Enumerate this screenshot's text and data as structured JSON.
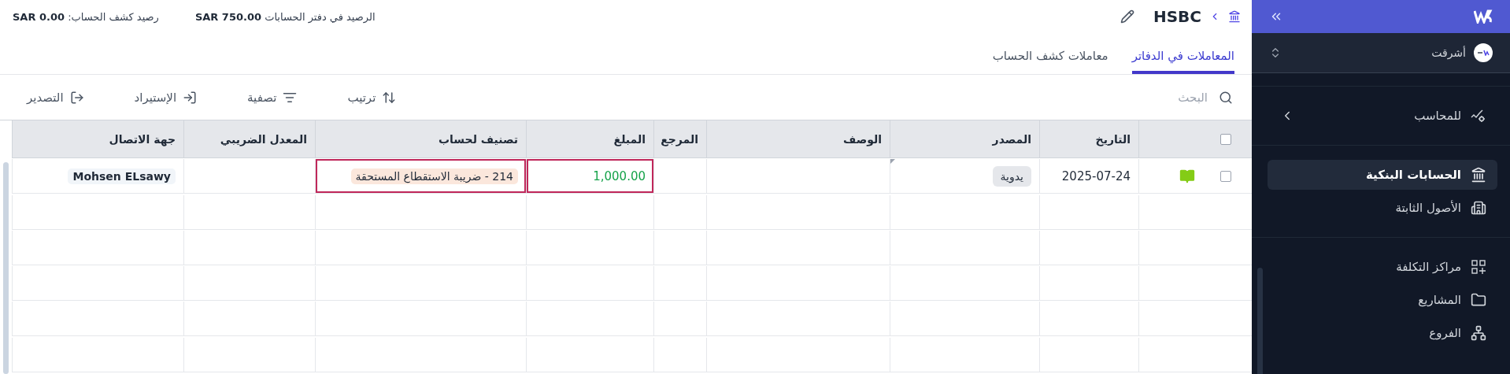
{
  "sidebar": {
    "org": {
      "name": "أشرقت"
    },
    "sections": [
      [
        {
          "label": "للمحاسب",
          "kind": "accountant",
          "selected": false,
          "submenu": true
        }
      ],
      [
        {
          "label": "الحسابات البنكية",
          "kind": "bank",
          "selected": true,
          "submenu": false
        },
        {
          "label": "الأصول الثابتة",
          "kind": "building",
          "selected": false,
          "submenu": false
        }
      ],
      [
        {
          "label": "مراكز التكلفة",
          "kind": "grid",
          "selected": false,
          "submenu": false
        },
        {
          "label": "المشاريع",
          "kind": "folder",
          "selected": false,
          "submenu": false
        },
        {
          "label": "الفروع",
          "kind": "branches",
          "selected": false,
          "submenu": false
        }
      ]
    ]
  },
  "header": {
    "title": "HSBC",
    "balances": [
      "الرصيد في دفتر الحسابات **SAR 750.00**",
      "رصيد كشف الحساب: **SAR 0.00**"
    ]
  },
  "tabs": [
    {
      "label": "المعاملات في الدفاتر",
      "selected": true
    },
    {
      "label": "معاملات كشف الحساب",
      "selected": false
    }
  ],
  "toolbar": {
    "search": {
      "placeholder": "البحث"
    },
    "buttons": [
      {
        "label": "ترتيب",
        "kind": "sort"
      },
      {
        "label": "تصفية",
        "kind": "filter"
      },
      {
        "label": "الإستيراد",
        "kind": "import"
      },
      {
        "label": "التصدير",
        "kind": "export"
      }
    ]
  },
  "table": {
    "select_all": {
      "checked": false
    },
    "columns": [
      {
        "label": "التاريخ"
      },
      {
        "label": "المصدر"
      },
      {
        "label": "الوصف"
      },
      {
        "label": "المرجع"
      },
      {
        "label": "المبلغ"
      },
      {
        "label": "تصنيف لحساب"
      },
      {
        "label": "المعدل الضريبي"
      },
      {
        "label": "جهة الاتصال"
      }
    ],
    "rows": [
      {
        "checked": false,
        "cells": [
          {
            "kind": "text",
            "text": "2025-07-24",
            "selected": false
          },
          {
            "kind": "source",
            "text": "يدوية",
            "selected": false
          },
          {
            "kind": "empty",
            "selected": false
          },
          {
            "kind": "empty",
            "selected": false
          },
          {
            "kind": "amount",
            "text": "1,000.00",
            "selected": true
          },
          {
            "kind": "account",
            "text": "214 - ضريبة الاستقطاع المستحقة",
            "selected": true
          },
          {
            "kind": "empty",
            "selected": false
          },
          {
            "kind": "contact",
            "text": "Mohsen ELsawy",
            "selected": false
          }
        ]
      }
    ]
  }
}
